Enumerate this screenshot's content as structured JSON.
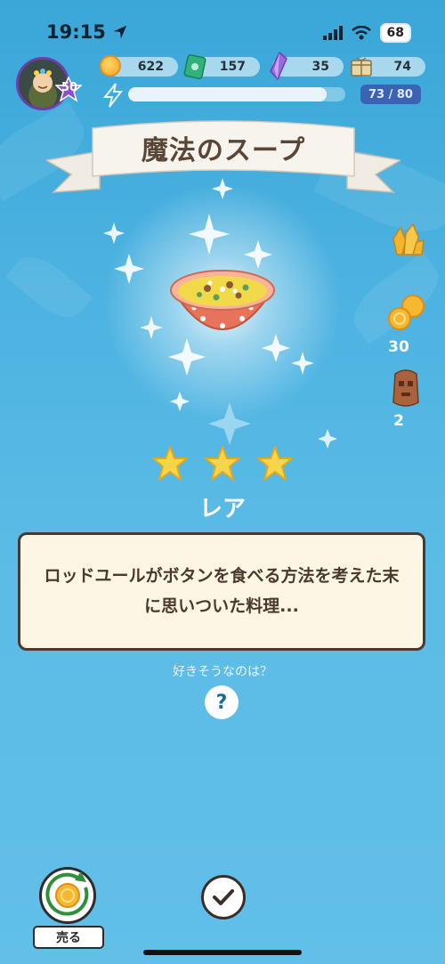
{
  "status_bar": {
    "time": "19:15",
    "battery": "68"
  },
  "player": {
    "level": "50"
  },
  "currencies": [
    {
      "name": "coin-icon",
      "value": "622"
    },
    {
      "name": "ticket-icon",
      "value": "157"
    },
    {
      "name": "crystal-icon",
      "value": "35"
    },
    {
      "name": "parcel-icon",
      "value": "74"
    }
  ],
  "energy": {
    "current": 73,
    "max": 80,
    "label": "73 / 80"
  },
  "item": {
    "title": "魔法のスープ",
    "rarity": "レア",
    "stars": 3,
    "description": "ロッドユールがボタンを食べる方法を考え​た末に思いついた料理..."
  },
  "side_rewards": [
    {
      "name": "gold-ore-icon",
      "count": ""
    },
    {
      "name": "coins-icon",
      "count": "30"
    },
    {
      "name": "mask-icon",
      "count": "2"
    }
  ],
  "hint": {
    "label": "好きそうなのは？",
    "help_symbol": "?"
  },
  "actions": {
    "sell_label": "売る"
  },
  "colors": {
    "accent": "#3a63b4",
    "sky": "#4fb4e2",
    "panel": "#fdf6e5",
    "ink": "#4a3a2e"
  }
}
